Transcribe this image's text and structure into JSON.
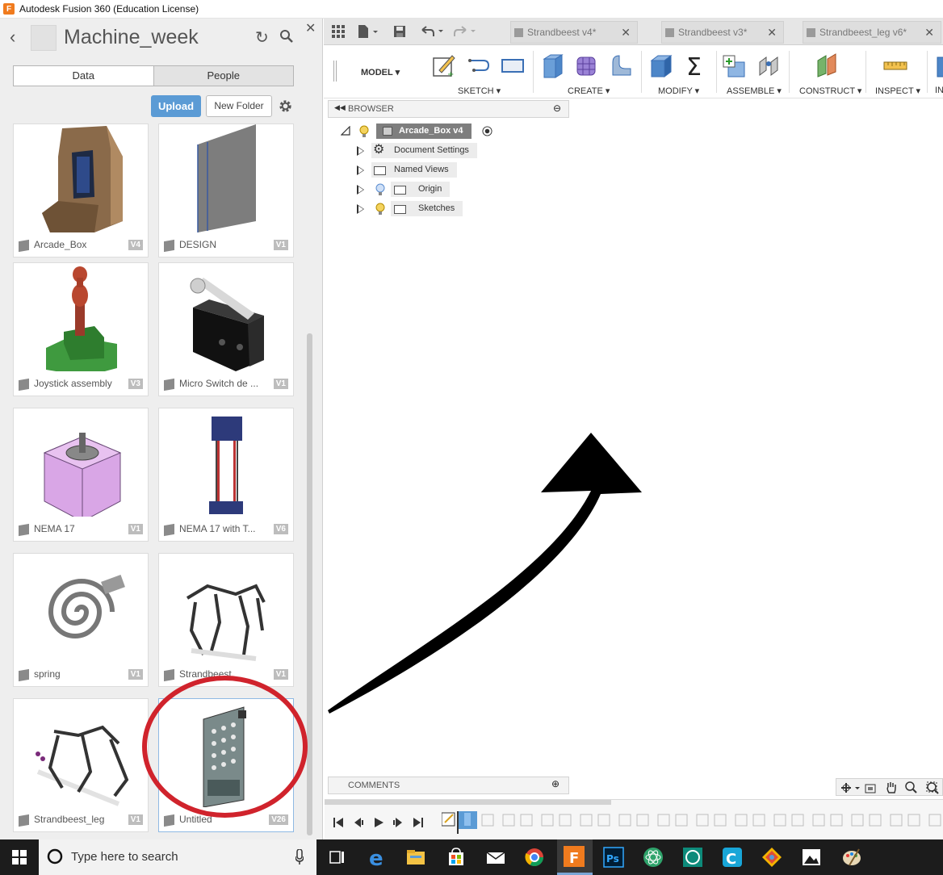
{
  "window": {
    "title": "Autodesk Fusion 360 (Education License)",
    "app_icon_letter": "F"
  },
  "data_panel": {
    "project_title": "Machine_week",
    "tabs": [
      "Data",
      "People"
    ],
    "active_tab": "Data",
    "upload_label": "Upload",
    "new_folder_label": "New Folder",
    "files": [
      {
        "name": "Arcade_Box",
        "version": "V4"
      },
      {
        "name": "DESIGN",
        "version": "V1"
      },
      {
        "name": "Joystick assembly",
        "version": "V3"
      },
      {
        "name": "Micro Switch de ...",
        "version": "V1"
      },
      {
        "name": "NEMA 17",
        "version": "V1"
      },
      {
        "name": "NEMA 17 with T...",
        "version": "V6"
      },
      {
        "name": "spring",
        "version": "V1"
      },
      {
        "name": "Strandbeest",
        "version": "V1"
      },
      {
        "name": "Strandbeest_leg",
        "version": "V1"
      },
      {
        "name": "Untitled",
        "version": "V26"
      }
    ],
    "highlight_color": "#d0232c"
  },
  "doc_tabs": [
    "Strandbeest v4*",
    "Strandbeest v3*",
    "Strandbeest_leg v6*"
  ],
  "toolbar": {
    "workspace": "MODEL",
    "groups": [
      "SKETCH",
      "CREATE",
      "MODIFY",
      "ASSEMBLE",
      "CONSTRUCT",
      "INSPECT",
      "IN"
    ]
  },
  "browser": {
    "header": "BROWSER",
    "root": "Arcade_Box v4",
    "items": [
      "Document Settings",
      "Named Views",
      "Origin",
      "Sketches"
    ]
  },
  "comments": {
    "label": "COMMENTS"
  },
  "taskbar": {
    "search_placeholder": "Type here to search"
  },
  "colors": {
    "accent": "#5b9bd5",
    "fusion_orange": "#f07b1e"
  }
}
